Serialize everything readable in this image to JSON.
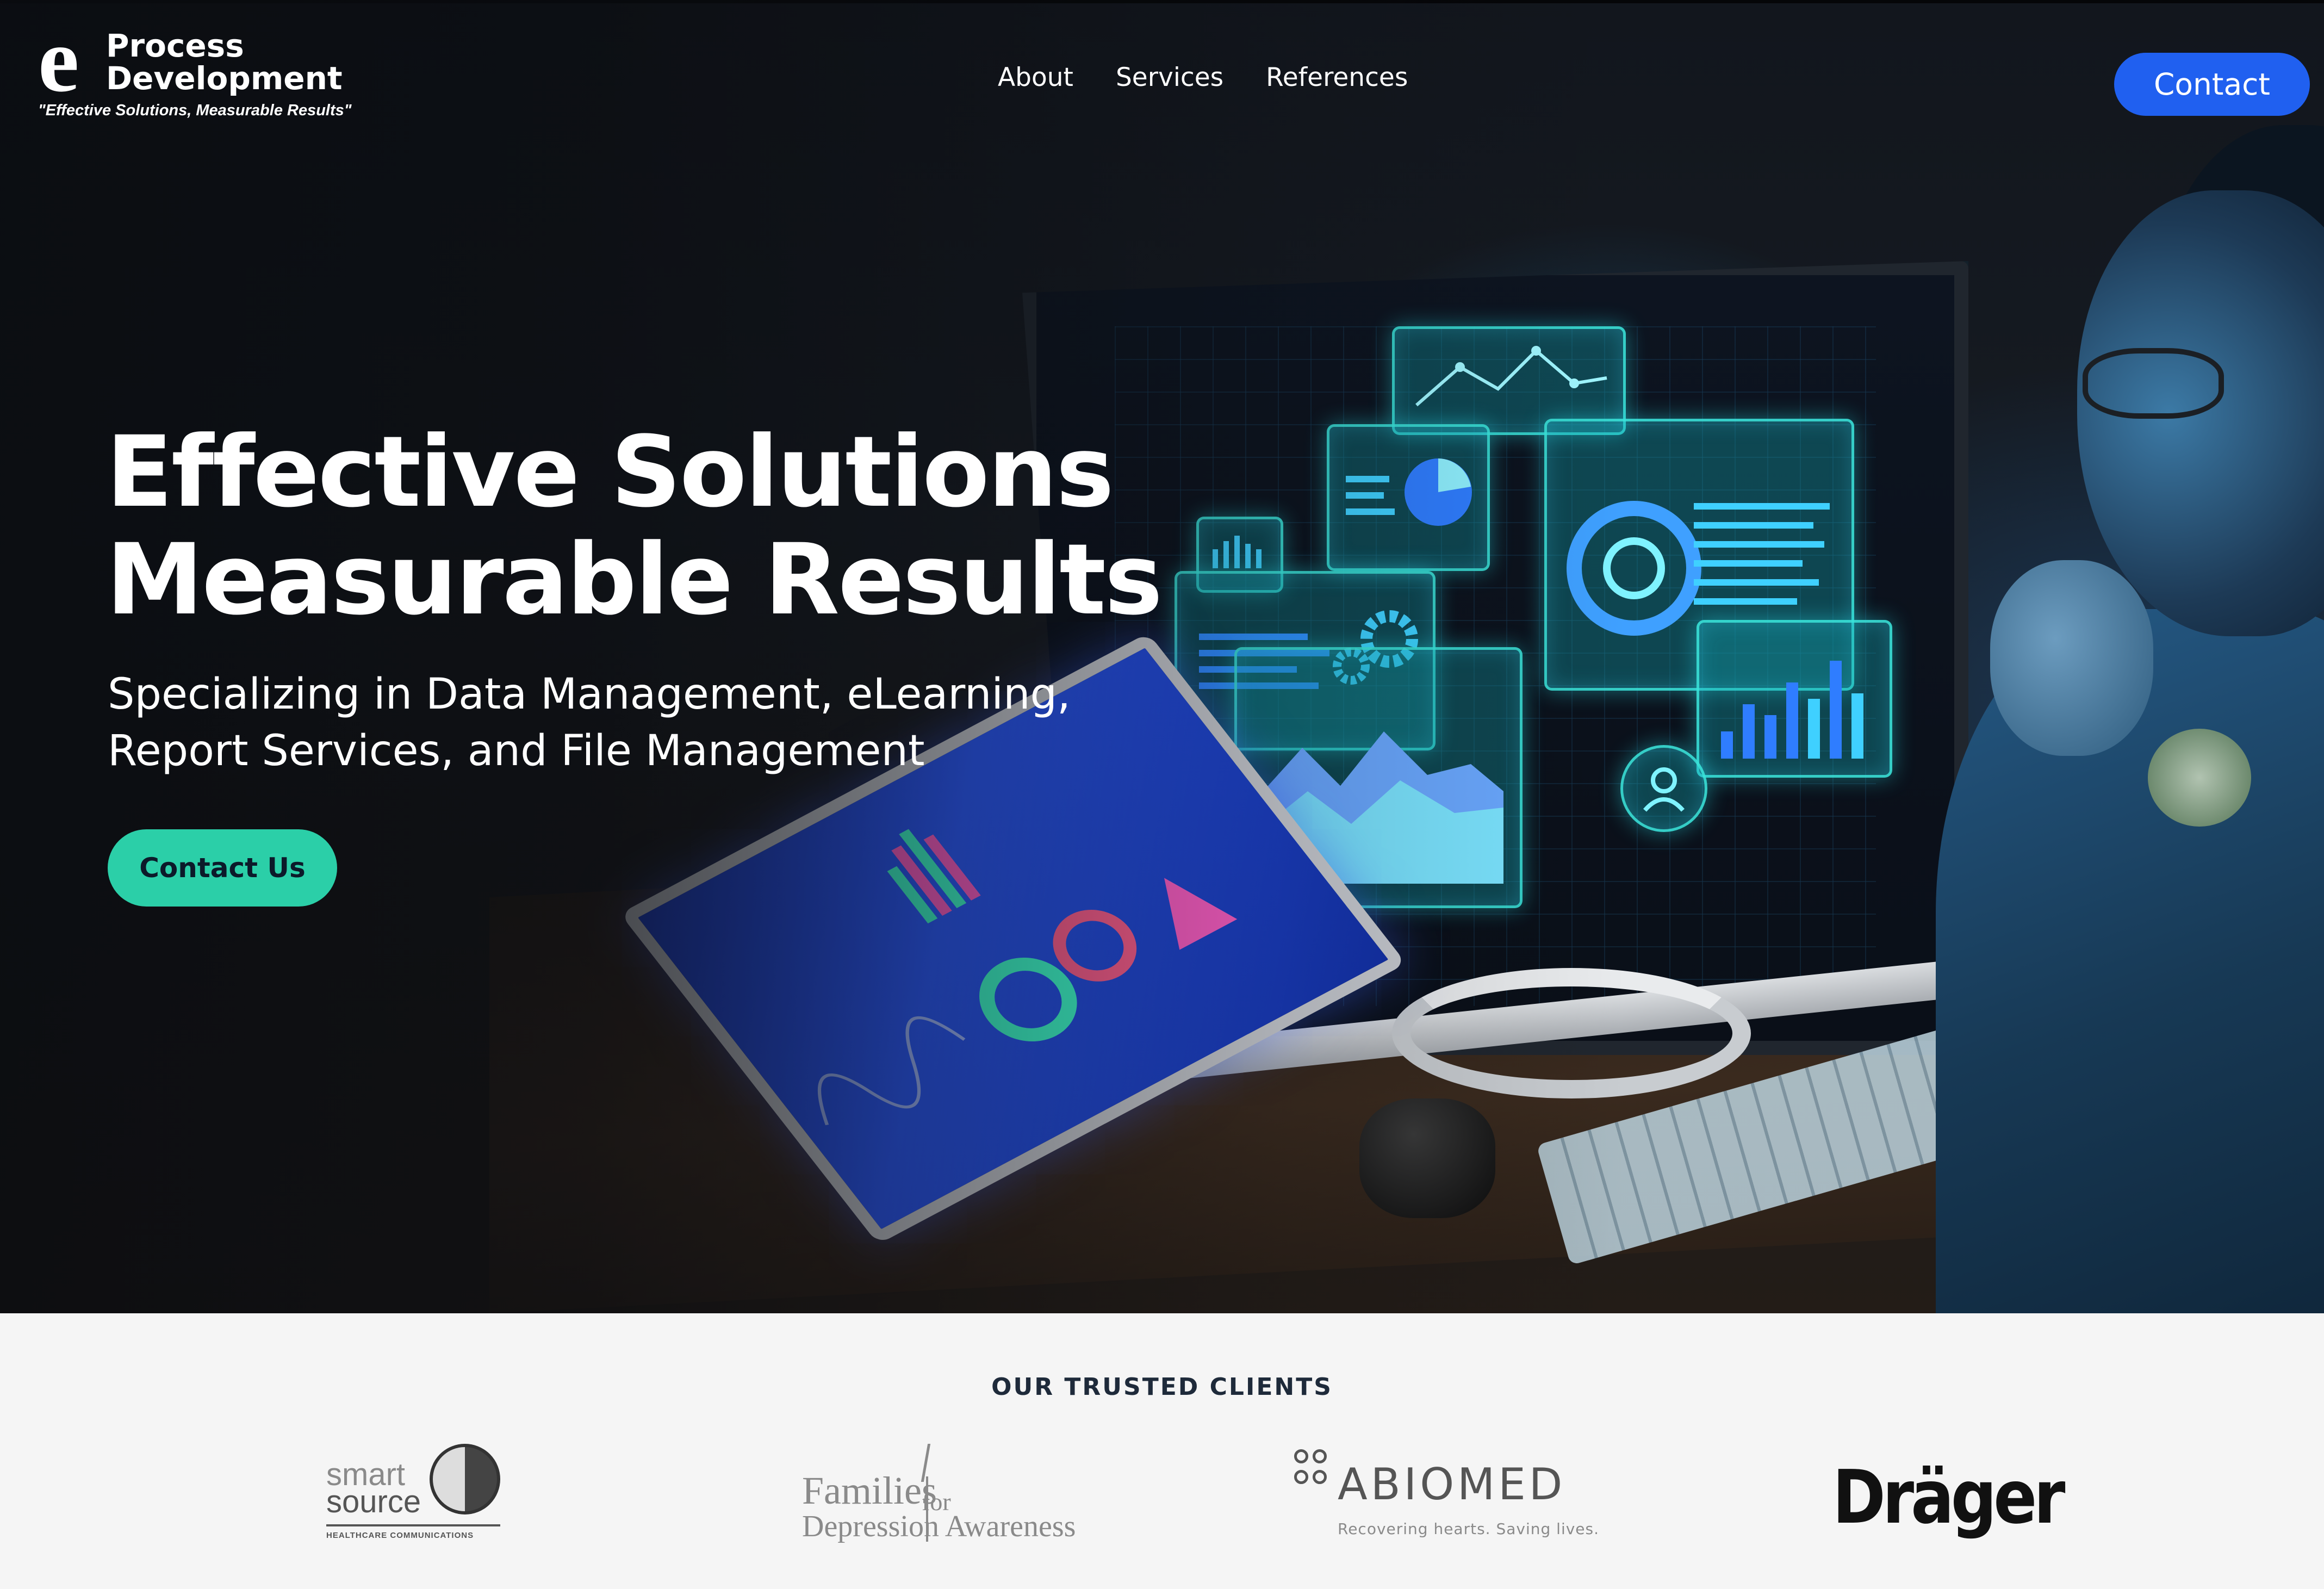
{
  "brand": {
    "logo_mark": "e",
    "logo_line1": "Process",
    "logo_line2": "Development",
    "tagline": "\"Effective Solutions, Measurable Results\""
  },
  "nav": {
    "items": [
      {
        "label": "About"
      },
      {
        "label": "Services"
      },
      {
        "label": "References"
      }
    ],
    "contact_label": "Contact"
  },
  "hero": {
    "headline_line1": "Effective Solutions",
    "headline_line2": "Measurable Results",
    "subhead_line1": "Specializing in Data Management, eLearning,",
    "subhead_line2": "Report Services, and File Management",
    "cta_label": "Contact Us"
  },
  "clients": {
    "title": "OUR TRUSTED CLIENTS",
    "logos": [
      {
        "name": "smart source",
        "line1": "smart",
        "line2": "source",
        "subtitle": "HEALTHCARE COMMUNICATIONS"
      },
      {
        "name": "Families for Depression Awareness",
        "line1": "Families",
        "for": "for",
        "line2": "Depression Awareness"
      },
      {
        "name": "ABIOMED",
        "line1": "ABIOMED",
        "subtitle": "Recovering hearts. Saving lives."
      },
      {
        "name": "Dräger",
        "line1": "Dräger"
      }
    ]
  },
  "colors": {
    "contact_button": "#2060f0",
    "cta_button": "#2bcfa8",
    "hero_background": "#12161d",
    "clients_background": "#f5f5f5"
  }
}
